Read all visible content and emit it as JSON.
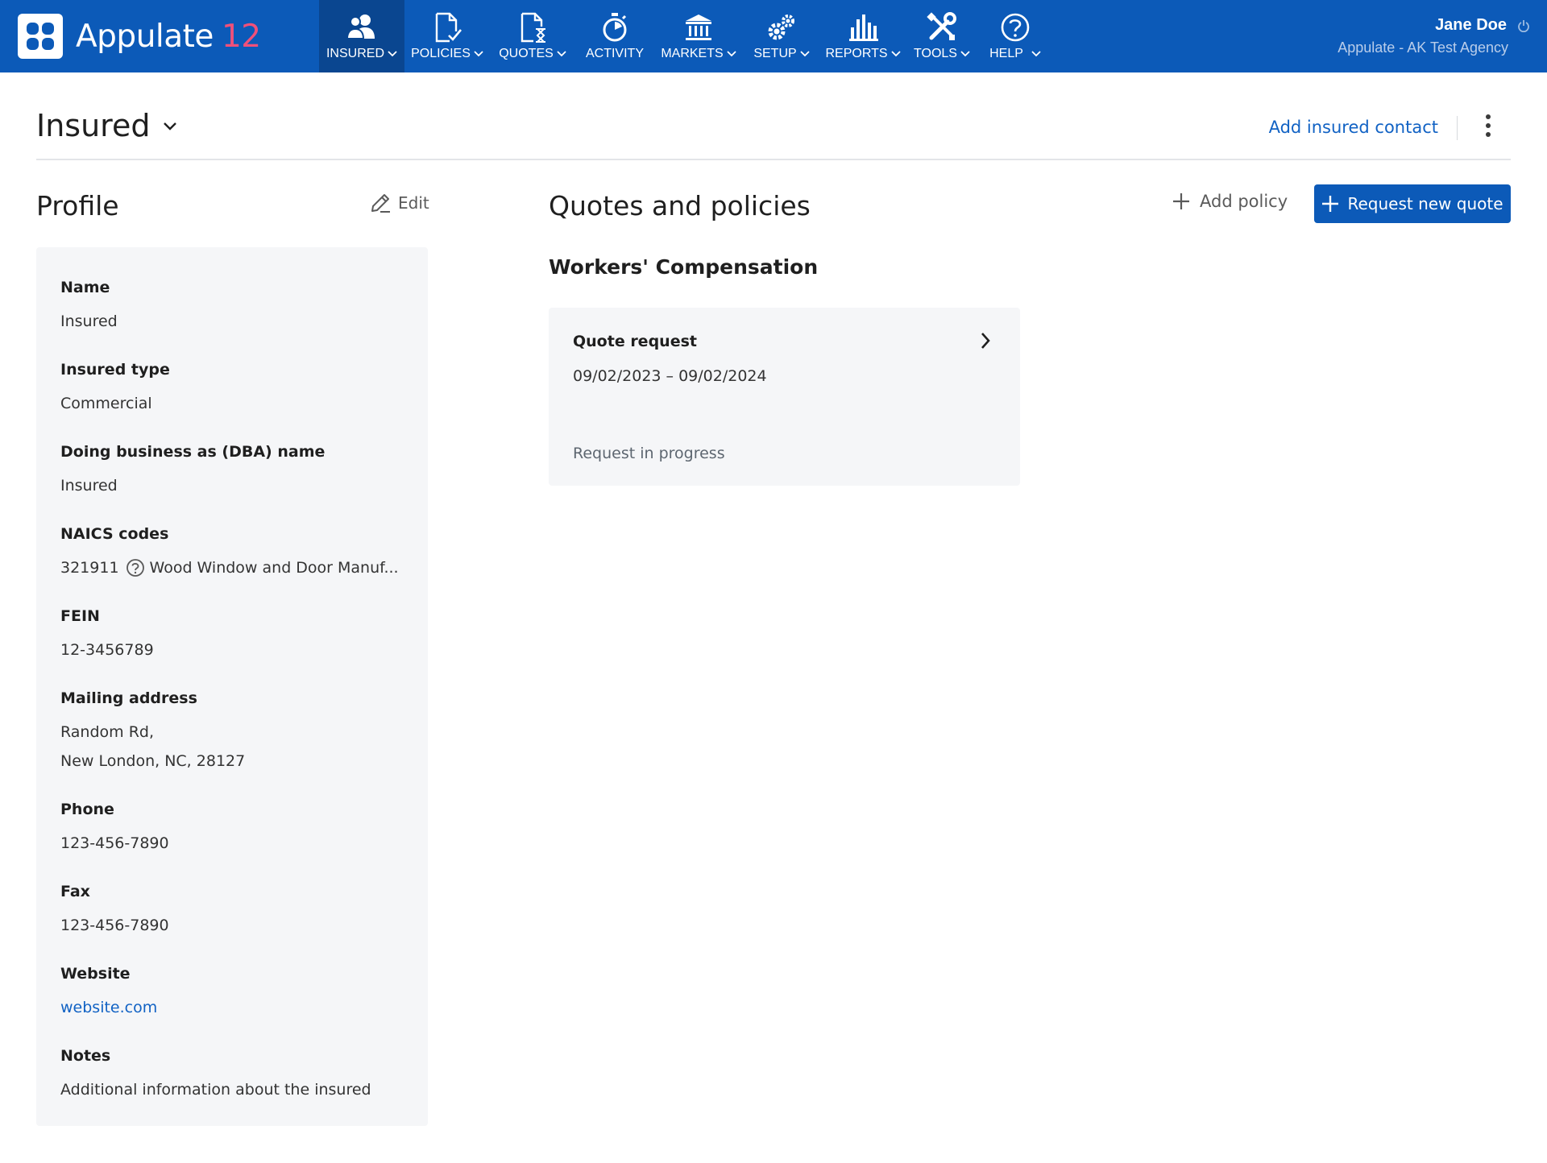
{
  "app": {
    "brand": "Appulate",
    "version": "12"
  },
  "nav": {
    "items": [
      {
        "label": "INSURED",
        "icon": "insured-users-icon",
        "has_dropdown": true,
        "active": true
      },
      {
        "label": "POLICIES",
        "icon": "policy-document-check-icon",
        "has_dropdown": true,
        "active": false
      },
      {
        "label": "QUOTES",
        "icon": "quote-document-hourglass-icon",
        "has_dropdown": true,
        "active": false
      },
      {
        "label": "ACTIVITY",
        "icon": "stopwatch-icon",
        "has_dropdown": false,
        "active": false
      },
      {
        "label": "MARKETS",
        "icon": "bank-building-icon",
        "has_dropdown": true,
        "active": false
      },
      {
        "label": "SETUP",
        "icon": "gears-icon",
        "has_dropdown": true,
        "active": false
      },
      {
        "label": "REPORTS",
        "icon": "bar-chart-icon",
        "has_dropdown": true,
        "active": false
      },
      {
        "label": "TOOLS",
        "icon": "wrench-screwdriver-icon",
        "has_dropdown": true,
        "active": false
      },
      {
        "label": "HELP",
        "icon": "question-circle-icon",
        "has_dropdown": true,
        "active": false
      }
    ]
  },
  "user": {
    "name": "Jane Doe",
    "agency": "Appulate - AK Test Agency"
  },
  "header": {
    "title": "Insured",
    "add_contact_label": "Add insured contact"
  },
  "profile": {
    "title": "Profile",
    "edit_label": "Edit",
    "fields": {
      "name": {
        "label": "Name",
        "value": "Insured"
      },
      "insured_type": {
        "label": "Insured type",
        "value": "Commercial"
      },
      "dba": {
        "label": "Doing business as (DBA) name",
        "value": "Insured"
      },
      "naics": {
        "label": "NAICS codes",
        "code": "321911",
        "description": "Wood Window and Door Manuf..."
      },
      "fein": {
        "label": "FEIN",
        "value": "12-3456789"
      },
      "mailing_address": {
        "label": "Mailing address",
        "line1": "Random Rd,",
        "line2": "New London, NC, 28127"
      },
      "phone": {
        "label": "Phone",
        "value": "123-456-7890"
      },
      "fax": {
        "label": "Fax",
        "value": "123-456-7890"
      },
      "website": {
        "label": "Website",
        "value": "website.com"
      },
      "notes": {
        "label": "Notes",
        "value": "Additional information about the insured"
      }
    }
  },
  "quotes": {
    "title": "Quotes and policies",
    "add_policy_label": "Add policy",
    "request_quote_label": "Request new quote",
    "lob_title": "Workers' Compensation",
    "card": {
      "title": "Quote request",
      "dates": "09/02/2023 – 09/02/2024",
      "status": "Request in progress"
    }
  },
  "colors": {
    "brand_blue": "#0c5ab8",
    "nav_active": "#0a4690",
    "version_pink": "#f0507a",
    "link_blue": "#1162c4",
    "card_bg": "#f5f6f8"
  }
}
